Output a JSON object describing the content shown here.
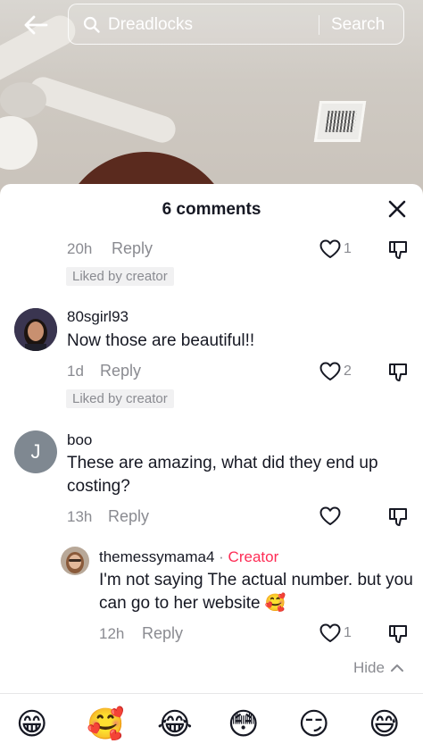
{
  "search": {
    "query": "Dreadlocks",
    "button_label": "Search"
  },
  "sheet": {
    "title": "6 comments"
  },
  "comment0": {
    "time": "20h",
    "reply_label": "Reply",
    "likes": "1",
    "badge": "Liked by creator"
  },
  "comment1": {
    "username": "80sgirl93",
    "text": "Now those are beautiful!!",
    "time": "1d",
    "reply_label": "Reply",
    "likes": "2",
    "badge": "Liked by creator"
  },
  "comment2": {
    "avatar_letter": "J",
    "username": "boo",
    "text": "These are amazing, what did they end up costing?",
    "time": "13h",
    "reply_label": "Reply"
  },
  "reply1": {
    "username": "themessymama4",
    "separator": " · ",
    "creator_label": "Creator",
    "text": "I'm not saying The actual number. but you can go to her website 🥰",
    "time": "12h",
    "reply_label": "Reply",
    "likes": "1"
  },
  "hide": {
    "label": "Hide"
  },
  "emoji_bar": [
    "😁",
    "🥰",
    "😂",
    "😳",
    "😏",
    "😅"
  ],
  "colors": {
    "accent": "#fe2c55",
    "secondary_text": "#8a8b91",
    "primary_text": "#161823"
  }
}
